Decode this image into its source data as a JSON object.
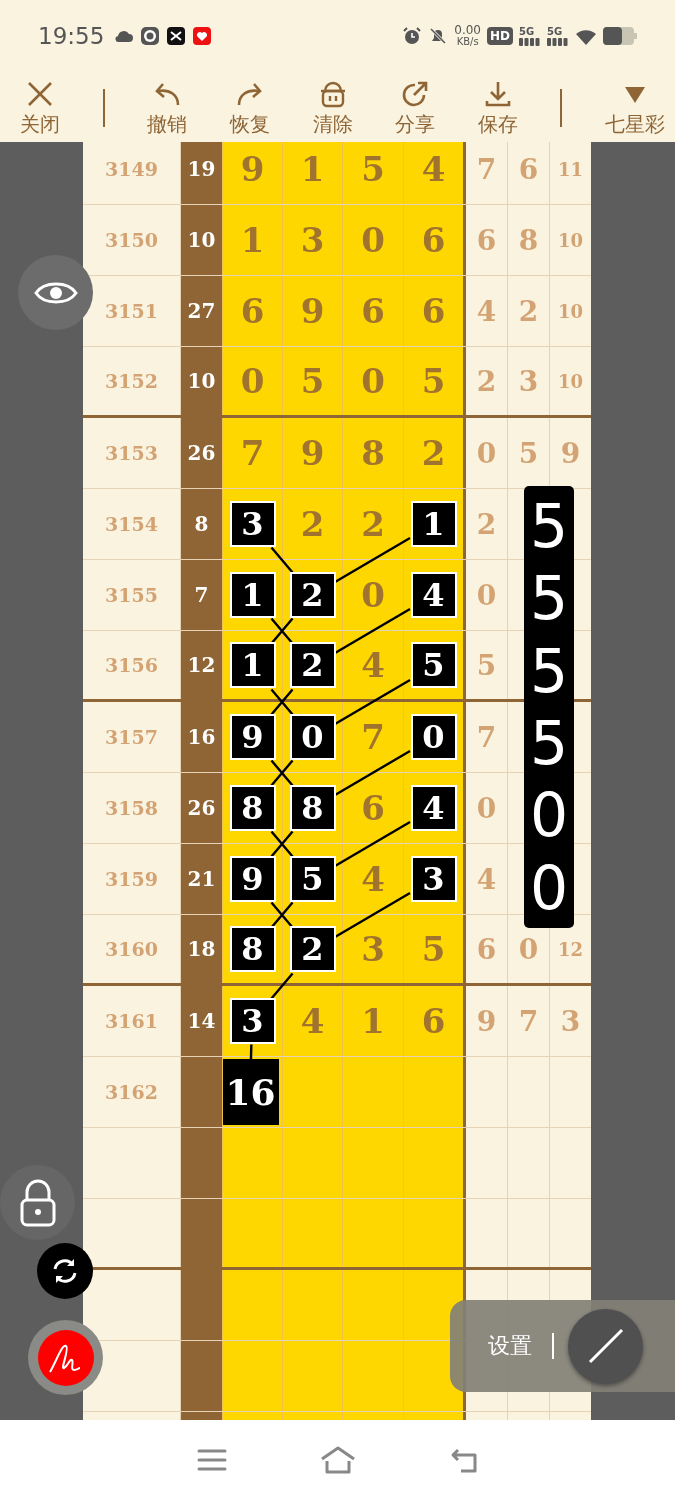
{
  "status_bar": {
    "time": "19:55",
    "net_speed": "0.00",
    "net_unit": "KB/s",
    "hd": "HD",
    "sim_labels": [
      "5G",
      "5G"
    ]
  },
  "toolbar": [
    {
      "label": "关闭",
      "kind": "close"
    },
    {
      "label": "撤销",
      "kind": "undo"
    },
    {
      "label": "恢复",
      "kind": "redo"
    },
    {
      "label": "清除",
      "kind": "clear"
    },
    {
      "label": "分享",
      "kind": "share"
    },
    {
      "label": "保存",
      "kind": "save"
    },
    {
      "label": "七星彩",
      "kind": "dropdown"
    }
  ],
  "rows": [
    {
      "issue": "3149",
      "sum": "19",
      "nums": [
        {
          "value": "9",
          "marked": false
        },
        {
          "value": "1",
          "marked": false
        },
        {
          "value": "5",
          "marked": false
        },
        {
          "value": "4",
          "marked": false
        }
      ],
      "tail": [
        "7",
        "6",
        "11"
      ]
    },
    {
      "issue": "3150",
      "sum": "10",
      "nums": [
        {
          "value": "1",
          "marked": false
        },
        {
          "value": "3",
          "marked": false
        },
        {
          "value": "0",
          "marked": false
        },
        {
          "value": "6",
          "marked": false
        }
      ],
      "tail": [
        "6",
        "8",
        "10"
      ]
    },
    {
      "issue": "3151",
      "sum": "27",
      "nums": [
        {
          "value": "6",
          "marked": false
        },
        {
          "value": "9",
          "marked": false
        },
        {
          "value": "6",
          "marked": false
        },
        {
          "value": "6",
          "marked": false
        }
      ],
      "tail": [
        "4",
        "2",
        "10"
      ]
    },
    {
      "issue": "3152",
      "sum": "10",
      "nums": [
        {
          "value": "0",
          "marked": false
        },
        {
          "value": "5",
          "marked": false
        },
        {
          "value": "0",
          "marked": false
        },
        {
          "value": "5",
          "marked": false
        }
      ],
      "tail": [
        "2",
        "3",
        "10"
      ]
    },
    {
      "issue": "3153",
      "sum": "26",
      "nums": [
        {
          "value": "7",
          "marked": false
        },
        {
          "value": "9",
          "marked": false
        },
        {
          "value": "8",
          "marked": false
        },
        {
          "value": "2",
          "marked": false
        }
      ],
      "tail": [
        "0",
        "5",
        "9"
      ]
    },
    {
      "issue": "3154",
      "sum": "8",
      "nums": [
        {
          "value": "3",
          "marked": true
        },
        {
          "value": "2",
          "marked": false
        },
        {
          "value": "2",
          "marked": false
        },
        {
          "value": "1",
          "marked": true
        }
      ],
      "tail": [
        "2"
      ]
    },
    {
      "issue": "3155",
      "sum": "7",
      "nums": [
        {
          "value": "1",
          "marked": true
        },
        {
          "value": "2",
          "marked": true
        },
        {
          "value": "0",
          "marked": false
        },
        {
          "value": "4",
          "marked": true
        }
      ],
      "tail": [
        "0"
      ]
    },
    {
      "issue": "3156",
      "sum": "12",
      "nums": [
        {
          "value": "1",
          "marked": true
        },
        {
          "value": "2",
          "marked": true
        },
        {
          "value": "4",
          "marked": false
        },
        {
          "value": "5",
          "marked": true
        }
      ],
      "tail": [
        "5"
      ]
    },
    {
      "issue": "3157",
      "sum": "16",
      "nums": [
        {
          "value": "9",
          "marked": true
        },
        {
          "value": "0",
          "marked": true
        },
        {
          "value": "7",
          "marked": false
        },
        {
          "value": "0",
          "marked": true
        }
      ],
      "tail": [
        "7"
      ]
    },
    {
      "issue": "3158",
      "sum": "26",
      "nums": [
        {
          "value": "8",
          "marked": true
        },
        {
          "value": "8",
          "marked": true
        },
        {
          "value": "6",
          "marked": false
        },
        {
          "value": "4",
          "marked": true
        }
      ],
      "tail": [
        "0"
      ]
    },
    {
      "issue": "3159",
      "sum": "21",
      "nums": [
        {
          "value": "9",
          "marked": true
        },
        {
          "value": "5",
          "marked": true
        },
        {
          "value": "4",
          "marked": false
        },
        {
          "value": "3",
          "marked": true
        }
      ],
      "tail": [
        "4"
      ]
    },
    {
      "issue": "3160",
      "sum": "18",
      "nums": [
        {
          "value": "8",
          "marked": true
        },
        {
          "value": "2",
          "marked": true
        },
        {
          "value": "3",
          "marked": false
        },
        {
          "value": "5",
          "marked": false
        }
      ],
      "tail": [
        "6",
        "0",
        "12"
      ]
    },
    {
      "issue": "3161",
      "sum": "14",
      "nums": [
        {
          "value": "3",
          "marked": true
        },
        {
          "value": "4",
          "marked": false
        },
        {
          "value": "1",
          "marked": false
        },
        {
          "value": "6",
          "marked": false
        }
      ],
      "tail": [
        "9",
        "7",
        "3"
      ]
    },
    {
      "issue": "3162",
      "predicted": "16"
    }
  ],
  "side_column": [
    "5",
    "5",
    "5",
    "5",
    "0",
    "0"
  ],
  "settings_panel": {
    "label": "设置"
  }
}
